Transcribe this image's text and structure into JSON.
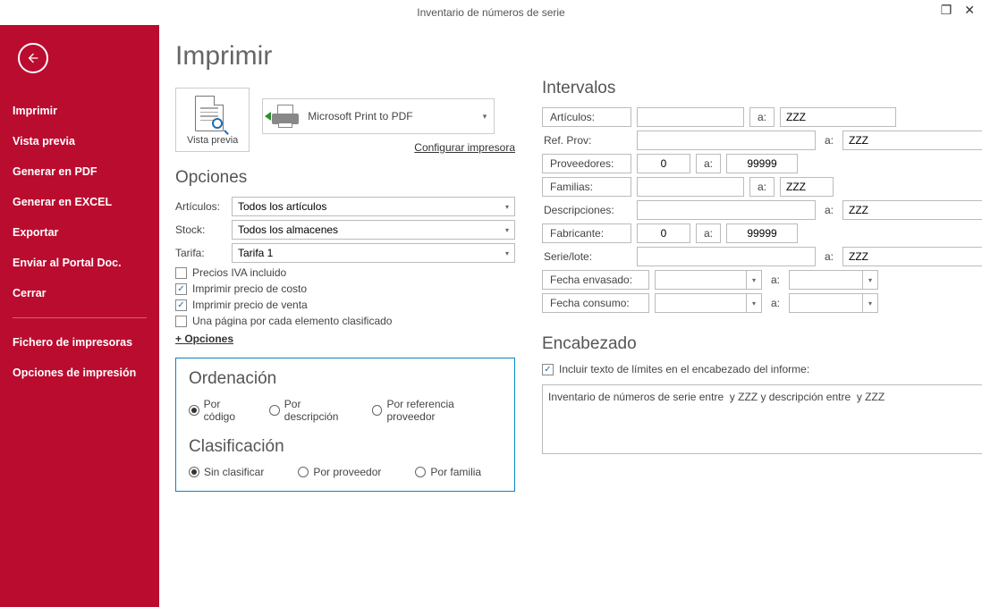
{
  "window": {
    "title": "Inventario de números de serie"
  },
  "sidebar": {
    "items": [
      "Imprimir",
      "Vista previa",
      "Generar en PDF",
      "Generar en EXCEL",
      "Exportar",
      "Enviar al Portal Doc.",
      "Cerrar"
    ],
    "items2": [
      "Fichero de impresoras",
      "Opciones de impresión"
    ]
  },
  "page": {
    "title": "Imprimir",
    "preview_label": "Vista previa",
    "printer_name": "Microsoft Print to PDF",
    "config_printer": "Configurar impresora"
  },
  "options": {
    "heading": "Opciones",
    "rows": {
      "articulos_label": "Artículos:",
      "articulos_value": "Todos los artículos",
      "stock_label": "Stock:",
      "stock_value": "Todos los almacenes",
      "tarifa_label": "Tarifa:",
      "tarifa_value": "Tarifa 1"
    },
    "checks": {
      "iva": {
        "label": "Precios IVA incluido",
        "checked": false
      },
      "costo": {
        "label": "Imprimir precio de costo",
        "checked": true
      },
      "venta": {
        "label": "Imprimir precio de venta",
        "checked": true
      },
      "pagina": {
        "label": "Una página por cada elemento clasificado",
        "checked": false
      }
    },
    "more": "+ Opciones"
  },
  "ordering": {
    "heading": "Ordenación",
    "opts": [
      "Por código",
      "Por descripción",
      "Por referencia proveedor"
    ],
    "selected": 0
  },
  "classification": {
    "heading": "Clasificación",
    "opts": [
      "Sin clasificar",
      "Por proveedor",
      "Por familia"
    ],
    "selected": 0
  },
  "intervals": {
    "heading": "Intervalos",
    "a_label": "a:",
    "rows": [
      {
        "label": "Artículos:",
        "boxed": true,
        "from": "",
        "to": "ZZZ",
        "a_boxed": true,
        "to_w": 130
      },
      {
        "label": "Ref. Prov:",
        "boxed": false,
        "from": "",
        "to": "ZZZ",
        "from_w": 200,
        "to_w": 200
      },
      {
        "label": "Proveedores:",
        "boxed": true,
        "from": "0",
        "to": "99999",
        "a_boxed": true,
        "num": true
      },
      {
        "label": "Familias:",
        "boxed": true,
        "from": "",
        "to": "ZZZ",
        "a_boxed": true
      },
      {
        "label": "Descripciones:",
        "boxed": false,
        "from": "",
        "to": "ZZZ",
        "from_w": 200,
        "to_w": 200
      },
      {
        "label": "Fabricante:",
        "boxed": true,
        "from": "0",
        "to": "99999",
        "a_boxed": true,
        "num": true
      },
      {
        "label": "Serie/lote:",
        "boxed": false,
        "from": "",
        "to": "ZZZ",
        "from_w": 200,
        "to_w": 200
      }
    ],
    "dates": [
      {
        "label": "Fecha envasado:"
      },
      {
        "label": "Fecha consumo:"
      }
    ]
  },
  "header": {
    "heading": "Encabezado",
    "check_label": "Incluir texto de límites en el encabezado del informe:",
    "check_checked": true,
    "text": "Inventario de números de serie entre  y ZZZ y descripción entre  y ZZZ"
  }
}
